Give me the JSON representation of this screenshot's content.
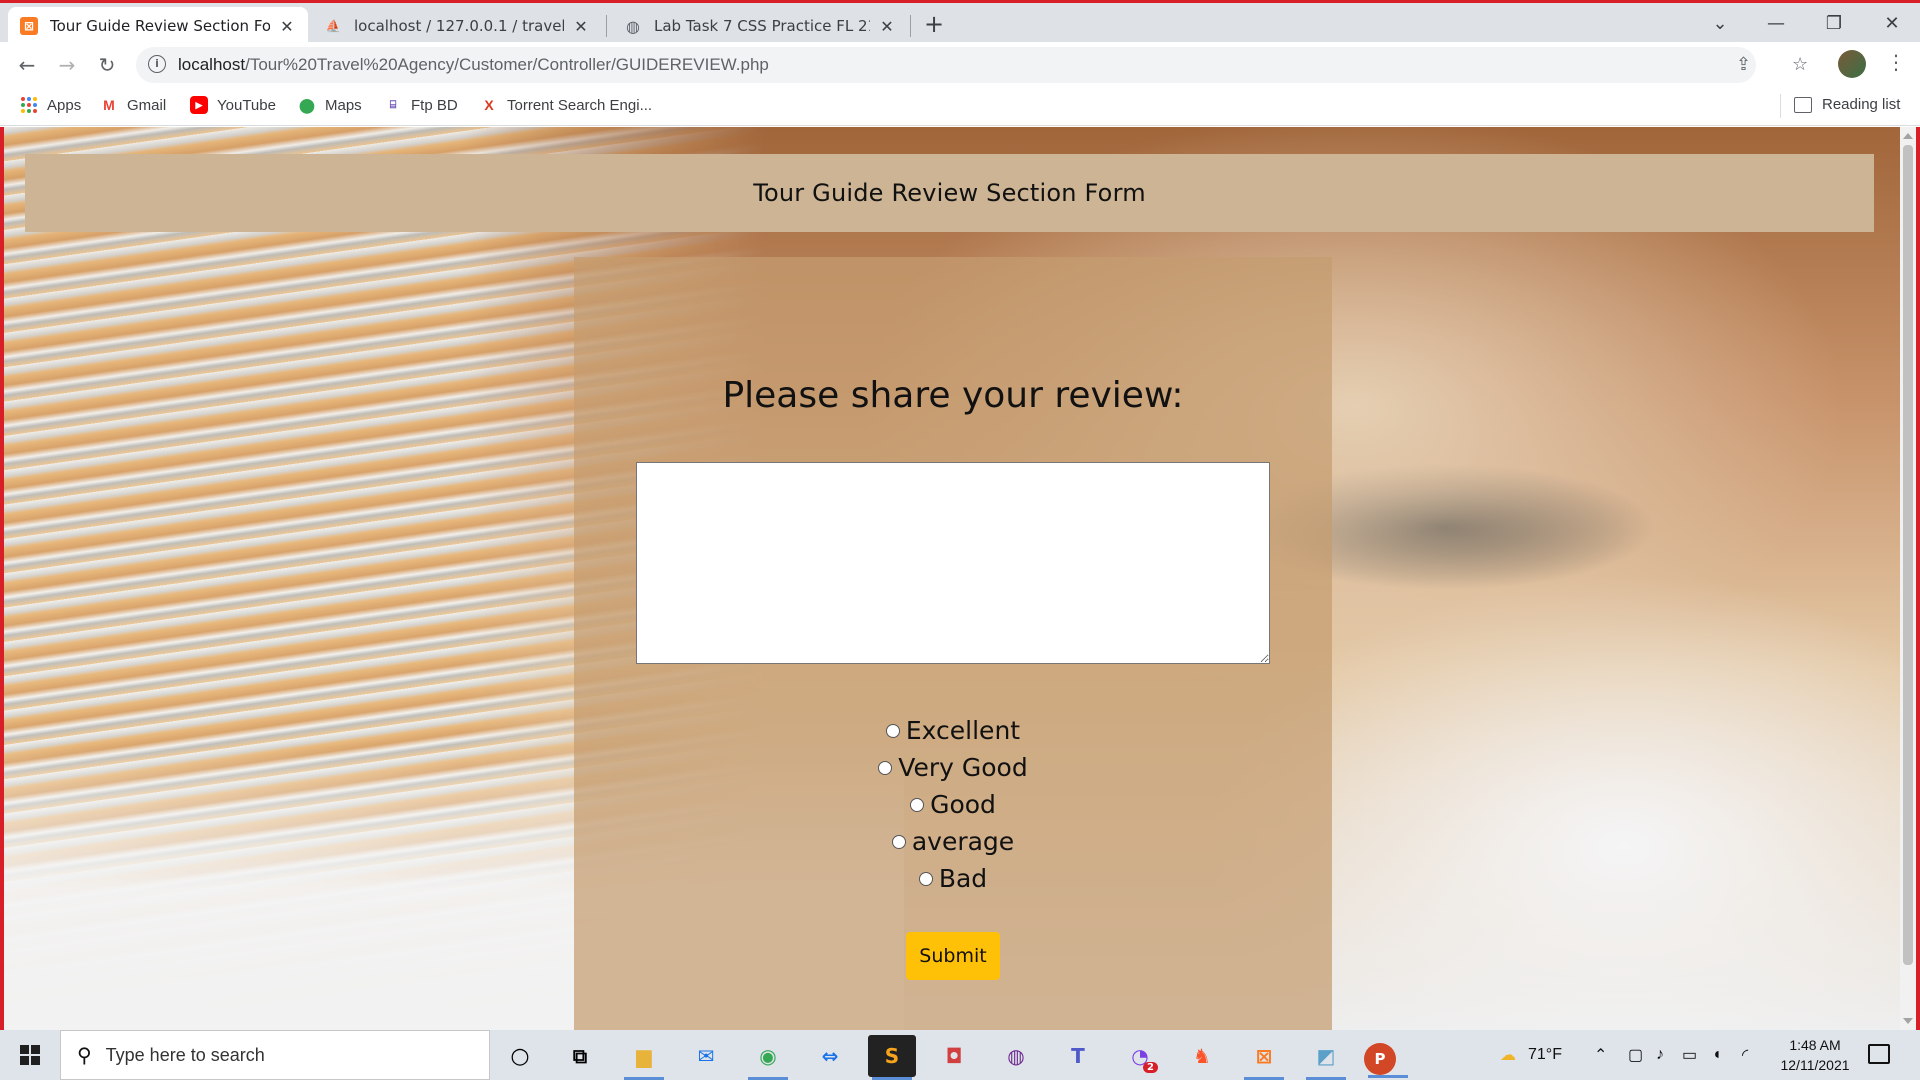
{
  "browser": {
    "tabs": [
      {
        "title": "Tour Guide Review Section Form",
        "favicon": "xampp-icon",
        "active": true
      },
      {
        "title": "localhost / 127.0.0.1 / travel-agen",
        "favicon": "phpmyadmin-icon",
        "active": false
      },
      {
        "title": "Lab Task 7 CSS Practice FL 21-22",
        "favicon": "globe-icon",
        "active": false
      }
    ],
    "new_tab_label": "+",
    "url_host": "localhost",
    "url_path": "/Tour%20Travel%20Agency/Customer/Controller/GUIDEREVIEW.php",
    "bookmarks": [
      {
        "label": "Apps",
        "icon": "apps-grid-icon"
      },
      {
        "label": "Gmail",
        "icon": "gmail-icon"
      },
      {
        "label": "YouTube",
        "icon": "youtube-icon"
      },
      {
        "label": "Maps",
        "icon": "maps-pin-icon"
      },
      {
        "label": "Ftp BD",
        "icon": "ftp-icon"
      },
      {
        "label": "Torrent Search Engi...",
        "icon": "torrent-x-icon"
      }
    ],
    "reading_list": "Reading list",
    "accent_color": "#d81e27"
  },
  "page": {
    "header_title": "Tour Guide Review Section Form",
    "prompt": "Please share your review:",
    "review_text": "",
    "ratings": [
      "Excellent",
      "Very Good",
      "Good",
      "average",
      "Bad"
    ],
    "submit_label": "Submit",
    "header_color": "#cdb494",
    "button_color": "#ffc107"
  },
  "taskbar": {
    "search_placeholder": "Type here to search",
    "weather": "71°F",
    "time": "1:48 AM",
    "date": "12/11/2021",
    "badge_count": "2"
  }
}
